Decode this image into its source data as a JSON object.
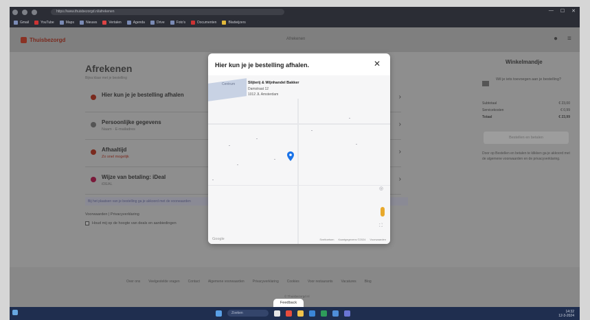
{
  "browser": {
    "url": "https://www.thuisbezorgd.nl/afrekenen",
    "bookmarks": [
      "Gmail",
      "YouTube",
      "Maps",
      "Nieuws",
      "Vertalen",
      "Agenda",
      "Drive",
      "Foto's",
      "Documenten",
      "Bladwijzers"
    ]
  },
  "site": {
    "logo_text": "Thuisbezorgd",
    "header_center": "Afrekenen",
    "checkout": {
      "title": "Afrekenen",
      "subtitle": "Bijna klaar met je bestelling",
      "steps": [
        {
          "title": "Hier kun je je bestelling afhalen",
          "subtitle": ""
        },
        {
          "title": "Persoonlijke gegevens",
          "subtitle": "Naam · E-mailadres"
        },
        {
          "title": "Afhaaltijd",
          "subtitle": "Zo snel mogelijk"
        },
        {
          "title": "Wijze van betaling: iDeal",
          "subtitle": "iDEAL"
        }
      ],
      "info_line": "Bij het plaatsen van je bestelling ga je akkoord met de voorwaarden",
      "terms": "Voorwaarden | Privacyverklaring",
      "terms_checkbox_label": "Houd mij op de hoogte van deals en aanbiedingen"
    },
    "cart": {
      "title": "Winkelmandje",
      "note": "Wil je iets toevoegen aan je bestelling?",
      "rows": [
        {
          "label": "Subtotaal",
          "value": "€ 23,00"
        },
        {
          "label": "Servicekosten",
          "value": "€ 0,99"
        },
        {
          "label": "Totaal",
          "value": "€ 23,99"
        }
      ],
      "button": "Bestellen en betalen",
      "small": "Door op Bestellen en betalen te klikken ga je akkoord met de algemene voorwaarden en de privacyverklaring."
    },
    "footer": {
      "links": [
        "Over ons",
        "Veelgestelde vragen",
        "Contact",
        "Algemene voorwaarden",
        "Privacyverklaring",
        "Cookies",
        "Voor restaurants",
        "Vacatures",
        "Blog"
      ],
      "copy": "© Thuisbezorgd.nl"
    },
    "feedback": "Feedback"
  },
  "modal": {
    "title": "Hier kun je je bestelling afhalen.",
    "close": "✕",
    "area_label": "Centrum",
    "store": {
      "name": "Slijterij & Wijnhandel Bakker",
      "street": "Damstraat 12",
      "city": "1012 JL Amsterdam"
    },
    "google": "Google",
    "footer_links": [
      "Sneltoetsen",
      "Kaartgegevens ©2024",
      "Voorwaarden"
    ]
  },
  "taskbar": {
    "search": "Zoeken",
    "time": "14:32",
    "date": "12-3-2024"
  },
  "colors": {
    "accent": "#8a3224",
    "pin": "#1a73e8",
    "taskbar": "#1f2e4f"
  }
}
